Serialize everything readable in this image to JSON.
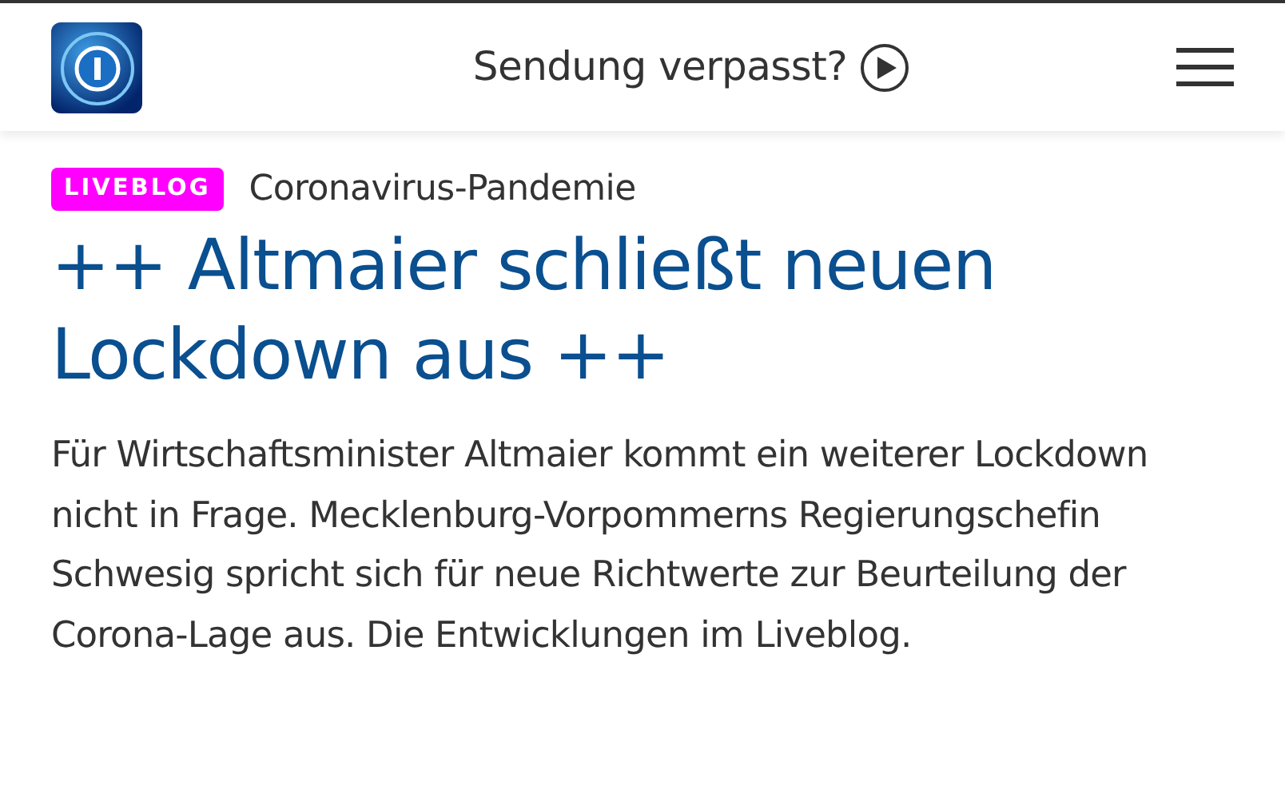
{
  "header": {
    "link": "Sendung verpasst?"
  },
  "article": {
    "badge": "LIVEBLOG",
    "topline": "Coronavirus-Pandemie",
    "headline": "++ Altmaier schließt neuen Lockdown aus ++",
    "teaser": "Für Wirtschaftsminister Altmaier kommt ein weiterer Lockdown nicht in Frage. Mecklenburg-Vorpommerns Regierungschefin Schwesig spricht sich für neue Richtwerte zur Beurteilung der Corona-Lage aus. Die Entwicklungen im Liveblog."
  }
}
